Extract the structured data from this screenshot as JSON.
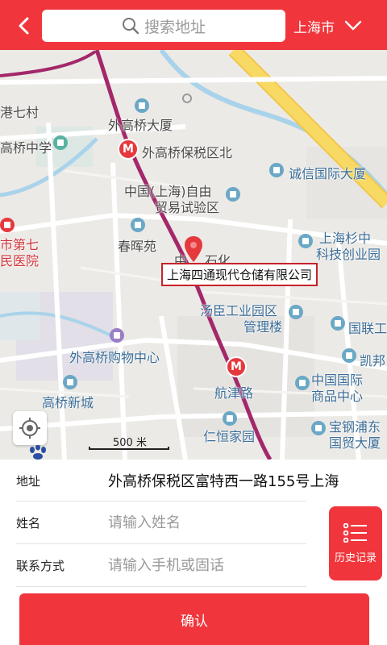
{
  "header": {
    "search_placeholder": "搜索地址",
    "city": "上海市"
  },
  "map": {
    "labels": {
      "l1": "港七村",
      "l2": "外高桥大厦",
      "l3": "高桥中学",
      "l4": "外高桥保税区北",
      "l5": "诚信国际大厦",
      "l6": "中国(上海)自由",
      "l7": "贸易试验区",
      "l8": "市第七",
      "l9": "民医院",
      "l10": "春晖苑",
      "l11": "中",
      "l12": "石化",
      "l13": "上海杉中",
      "l14": "科技创业园",
      "l15": "汤臣工业园区",
      "l16": "管理楼",
      "l17": "国联工",
      "l18": "外高桥购物中心",
      "l19": "凯邦",
      "l20": "高桥新城",
      "l21": "航津路",
      "l22": "中国国际",
      "l23": "商品中心",
      "l24": "宝钢浦东",
      "l25": "国贸大厦",
      "l26": "仁恒家园"
    },
    "callout": "上海四通现代仓储有限公司",
    "scale": "500 米"
  },
  "form": {
    "address_label": "地址",
    "address_value": "外高桥保税区富特西一路155号上海",
    "name_label": "姓名",
    "name_placeholder": "请输入姓名",
    "contact_label": "联系方式",
    "contact_placeholder": "请输入手机或固话",
    "history_label": "历史记录",
    "confirm_label": "确认"
  },
  "colors": {
    "brand": "#f0363c",
    "metro_line": "#a3286a",
    "highway": "#f7d964",
    "water": "#a9d3ea"
  }
}
